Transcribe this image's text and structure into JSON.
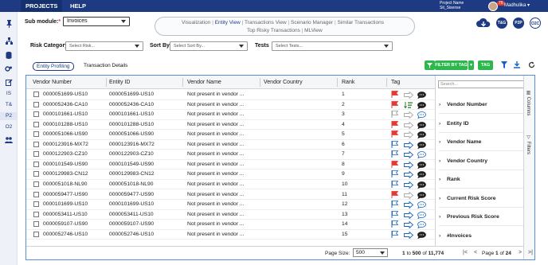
{
  "nav": {
    "projects": "PROJECTS",
    "help": "HELP"
  },
  "project": {
    "label": "Project Name",
    "name": "Sit_Sisense"
  },
  "user": {
    "name": "Madhulika",
    "notifications": "76"
  },
  "header_buttons": [
    "T&G",
    "P2P",
    "O2C"
  ],
  "sidebar": {
    "items": [
      "IS",
      "T&",
      "P2",
      "O2"
    ]
  },
  "submodule": {
    "label": "Sub module:",
    "required": "*",
    "value": "Invoices"
  },
  "views": {
    "row1": [
      "Visualization",
      "Entity View",
      "Transactions View",
      "Scenario Manager",
      "Similar Transactions"
    ],
    "row2": [
      "Top Risky Transactions",
      "MLView"
    ],
    "active": "Entity View"
  },
  "filters": {
    "risk_label": "Risk Category",
    "risk_placeholder": "Select Risk...",
    "sort_label": "Sort By",
    "sort_placeholder": "Select Sort By...",
    "tests_label": "Tests",
    "tests_placeholder": "Select Tests..."
  },
  "tabs": {
    "entity_profiling": "Entity Profiling",
    "transaction_details": "Transaction Details"
  },
  "toolbar": {
    "filter_by_tag": "FILTER BY TAG",
    "tag": "TAG"
  },
  "table": {
    "columns": [
      "Vendor Number",
      "Entity ID",
      "Vendor Name",
      "Vendor Country",
      "Rank",
      "Tag"
    ],
    "rows": [
      {
        "vendor": "0000051699-US10",
        "entity": "0000051699-US10",
        "name": "Not present in vendor ...",
        "rank": "1",
        "flag": "red",
        "arrow": "grey",
        "bubble": "dark"
      },
      {
        "vendor": "0000052436-CA10",
        "entity": "0000052436-CA10",
        "name": "Not present in vendor ...",
        "rank": "2",
        "flag": "red",
        "arrow": "list",
        "bubble": "dark"
      },
      {
        "vendor": "0000101661-US10",
        "entity": "0000101661-US10",
        "name": "Not present in vendor ...",
        "rank": "3",
        "flag": "grey",
        "arrow": "grey",
        "bubble": "blue"
      },
      {
        "vendor": "0000101288-US10",
        "entity": "0000101288-US10",
        "name": "Not present in vendor ...",
        "rank": "4",
        "flag": "red",
        "arrow": "grey",
        "bubble": "dark"
      },
      {
        "vendor": "0000051066-US90",
        "entity": "0000051066-US90",
        "name": "Not present in vendor ...",
        "rank": "5",
        "flag": "red",
        "arrow": "grey",
        "bubble": "dark"
      },
      {
        "vendor": "0000123916-MX72",
        "entity": "0000123916-MX72",
        "name": "Not present in vendor ...",
        "rank": "6",
        "flag": "blue",
        "arrow": "blue",
        "bubble": "dark"
      },
      {
        "vendor": "0000122903-CZ10",
        "entity": "0000122903-CZ10",
        "name": "Not present in vendor ...",
        "rank": "7",
        "flag": "blue",
        "arrow": "blue",
        "bubble": "blue"
      },
      {
        "vendor": "0000101549-US90",
        "entity": "0000101549-US90",
        "name": "Not present in vendor ...",
        "rank": "8",
        "flag": "red",
        "arrow": "blue",
        "bubble": "dark"
      },
      {
        "vendor": "0000129983-CN12",
        "entity": "0000129983-CN12",
        "name": "Not present in vendor ...",
        "rank": "9",
        "flag": "blue",
        "arrow": "blue",
        "bubble": "dark"
      },
      {
        "vendor": "0000051018-NL90",
        "entity": "0000051018-NL90",
        "name": "Not present in vendor ...",
        "rank": "10",
        "flag": "blue",
        "arrow": "blue",
        "bubble": "dark"
      },
      {
        "vendor": "0000059477-US90",
        "entity": "0000059477-US90",
        "name": "Not present in vendor ...",
        "rank": "11",
        "flag": "red",
        "arrow": "grey",
        "bubble": "dark"
      },
      {
        "vendor": "0000101699-US10",
        "entity": "0000101699-US10",
        "name": "Not present in vendor ...",
        "rank": "12",
        "flag": "blue",
        "arrow": "blue",
        "bubble": "blue"
      },
      {
        "vendor": "0000053411-US10",
        "entity": "0000053411-US10",
        "name": "Not present in vendor ...",
        "rank": "13",
        "flag": "blue",
        "arrow": "blue",
        "bubble": "blue"
      },
      {
        "vendor": "0000059107-US90",
        "entity": "0000059107-US90",
        "name": "Not present in vendor ...",
        "rank": "14",
        "flag": "blue",
        "arrow": "blue",
        "bubble": "blue"
      },
      {
        "vendor": "0000052746-US10",
        "entity": "0000052746-US10",
        "name": "Not present in vendor ...",
        "rank": "15",
        "flag": "blue",
        "arrow": "blue",
        "bubble": "dark"
      }
    ]
  },
  "columns_panel": {
    "search_placeholder": "Search...",
    "items": [
      "Vendor Number",
      "Entity ID",
      "Vendor Name",
      "Vendor Country",
      "Rank",
      "Current Risk Score",
      "Previous Risk Score",
      "#Invoices"
    ],
    "side_tabs": [
      "Columns",
      "Filters"
    ]
  },
  "footer": {
    "page_size_label": "Page Size:",
    "page_size": "500",
    "range_from": "1",
    "range_to_word": "to",
    "range_to": "500",
    "of_word": "of",
    "total": "11,774",
    "page_word": "Page",
    "page": "1",
    "pages": "24"
  },
  "colors": {
    "brand": "#1e3a82",
    "accent_green": "#2db84d",
    "flag_red": "#e53935",
    "tag_blue": "#1565c0"
  }
}
